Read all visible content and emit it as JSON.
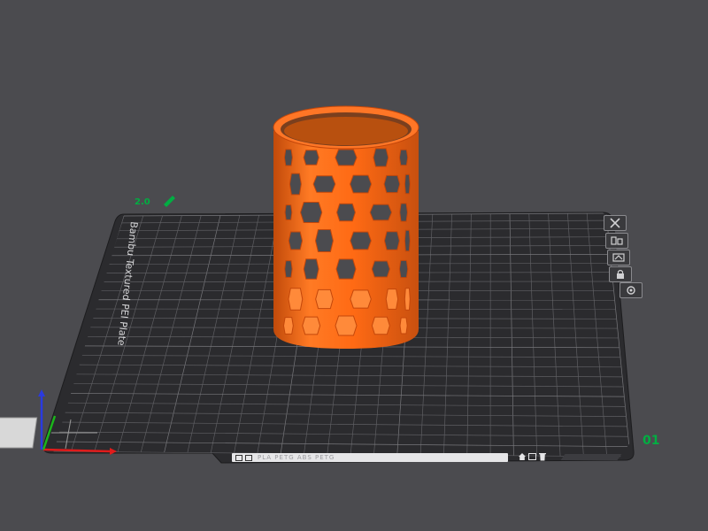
{
  "scene": {
    "plate_label": "Bambu Textured PEI Plate",
    "plate_number": "01",
    "height_readout": "2.0",
    "status_bar_text": "PLA PETG ABS PETG"
  },
  "colors": {
    "background": "#4b4b4f",
    "plate": "#2b2b2e",
    "grid": "#6a6a6e",
    "model_orange": "#ff6a14",
    "model_shadow": "#c4470a",
    "accent_green": "#00ae42",
    "axis_x": "#e01b1b",
    "axis_y": "#1bb51b",
    "axis_z": "#2a3ae0"
  },
  "icons": {
    "plate_buttons": [
      "close-icon",
      "arrange-icon",
      "orient-icon",
      "lock-icon",
      "settings-icon"
    ],
    "status_buttons": [
      "home-icon",
      "view-icon",
      "delete-icon"
    ]
  }
}
